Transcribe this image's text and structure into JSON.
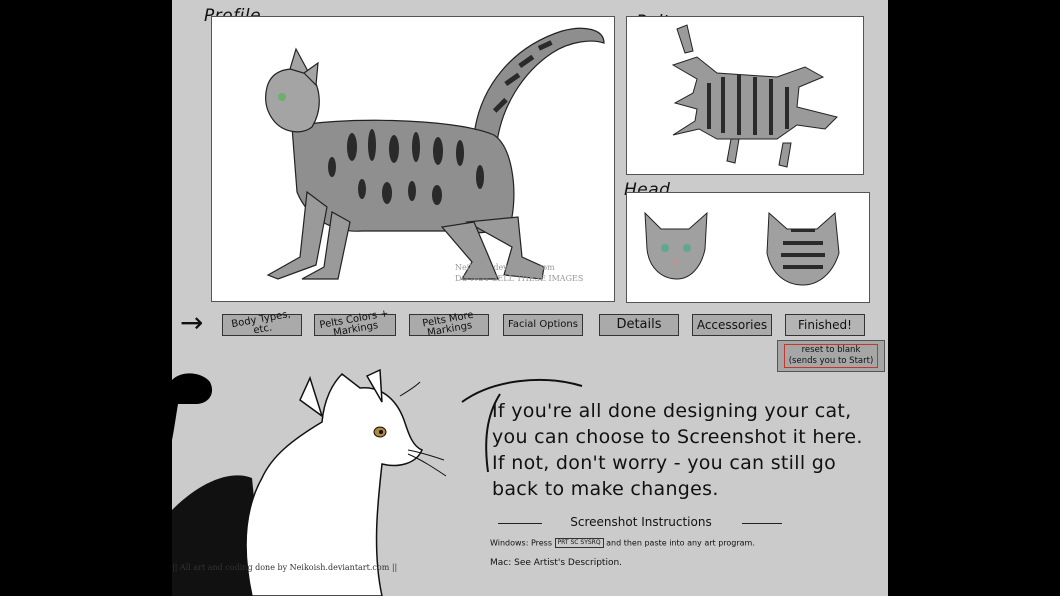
{
  "labels": {
    "profile": "Profile",
    "pelt": "Pelt",
    "head": "Head"
  },
  "watermark": {
    "line1": "Neikoish.deviantart.com",
    "line2": "DO NOT SELL THESE IMAGES"
  },
  "nav": {
    "arrow": "→",
    "buttons": [
      {
        "label": "Body Types, etc."
      },
      {
        "label": "Pelts Colors + Markings"
      },
      {
        "label": "Pelts More Markings"
      },
      {
        "label": "Facial Options"
      },
      {
        "label": "Details"
      },
      {
        "label": "Accessories"
      },
      {
        "label": "Finished!"
      }
    ]
  },
  "reset": {
    "line1": "reset to blank",
    "line2": "(sends you to Start)"
  },
  "message": "If you're all done designing your cat, you can choose to Screenshot it here. If not, don't worry - you can still go back to make changes.",
  "screenshot": {
    "title": "Screenshot Instructions",
    "windows_prefix": "Windows: Press",
    "windows_key": "PRT SC SYSRQ",
    "windows_suffix": "and then paste into any art program.",
    "mac": "Mac: See Artist's Description."
  },
  "credit": "|| All art and coding done by Neikoish.deviantart.com ||",
  "colors": {
    "stage_bg": "#cbcbcb",
    "button_bg": "#aaaaaa",
    "reset_border": "#c0392b",
    "letterbox": "#000000"
  }
}
